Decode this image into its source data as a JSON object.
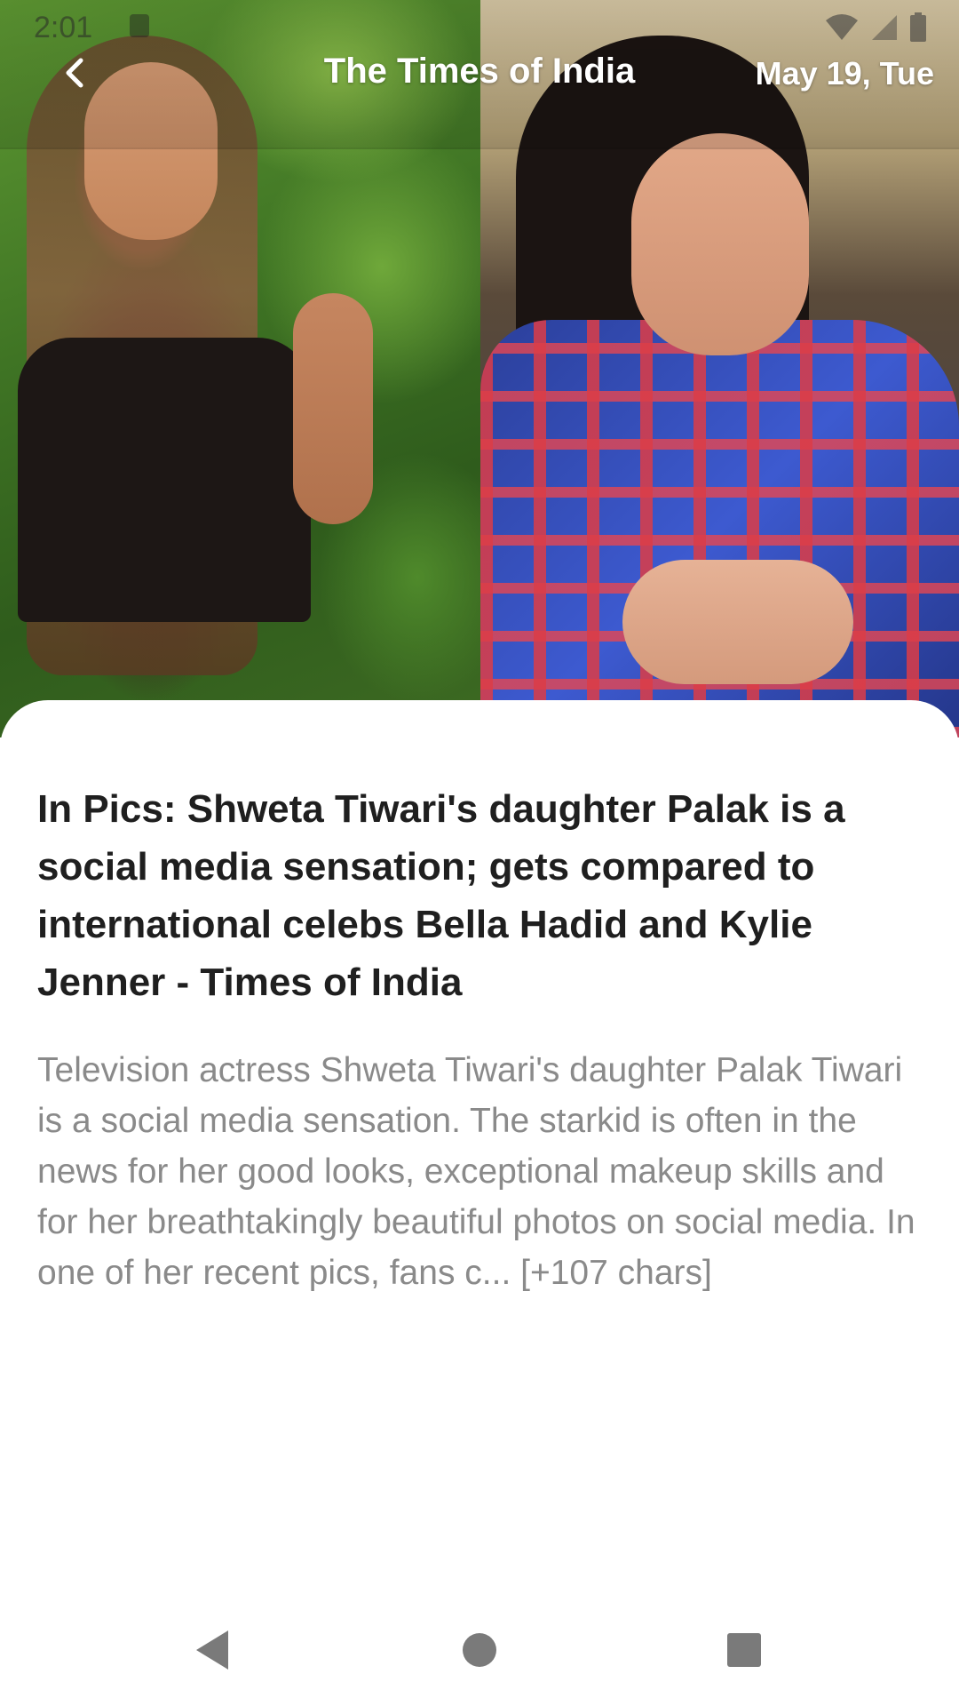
{
  "status_bar": {
    "time": "2:01"
  },
  "app_bar": {
    "title": "The Times of India",
    "date": "May 19, Tue"
  },
  "article": {
    "headline": "In Pics: Shweta Tiwari's daughter Palak is a social media sensation; gets compared to international celebs Bella Hadid and Kylie Jenner - Times of India",
    "description": "Television actress Shweta Tiwari's daughter Palak Tiwari is a social media sensation. The starkid is often in the news for her good looks, exceptional makeup skills and for her breathtakingly beautiful photos on social media. In one of her recent pics, fans c... [+107 chars]"
  },
  "icons": {
    "back": "chevron-left-icon",
    "nav_back": "triangle-back-icon",
    "nav_home": "circle-home-icon",
    "nav_recent": "square-recents-icon"
  },
  "colors": {
    "headline": "#1f1f1f",
    "description": "#8a8a8a",
    "nav_icons": "#7a7a7a"
  }
}
